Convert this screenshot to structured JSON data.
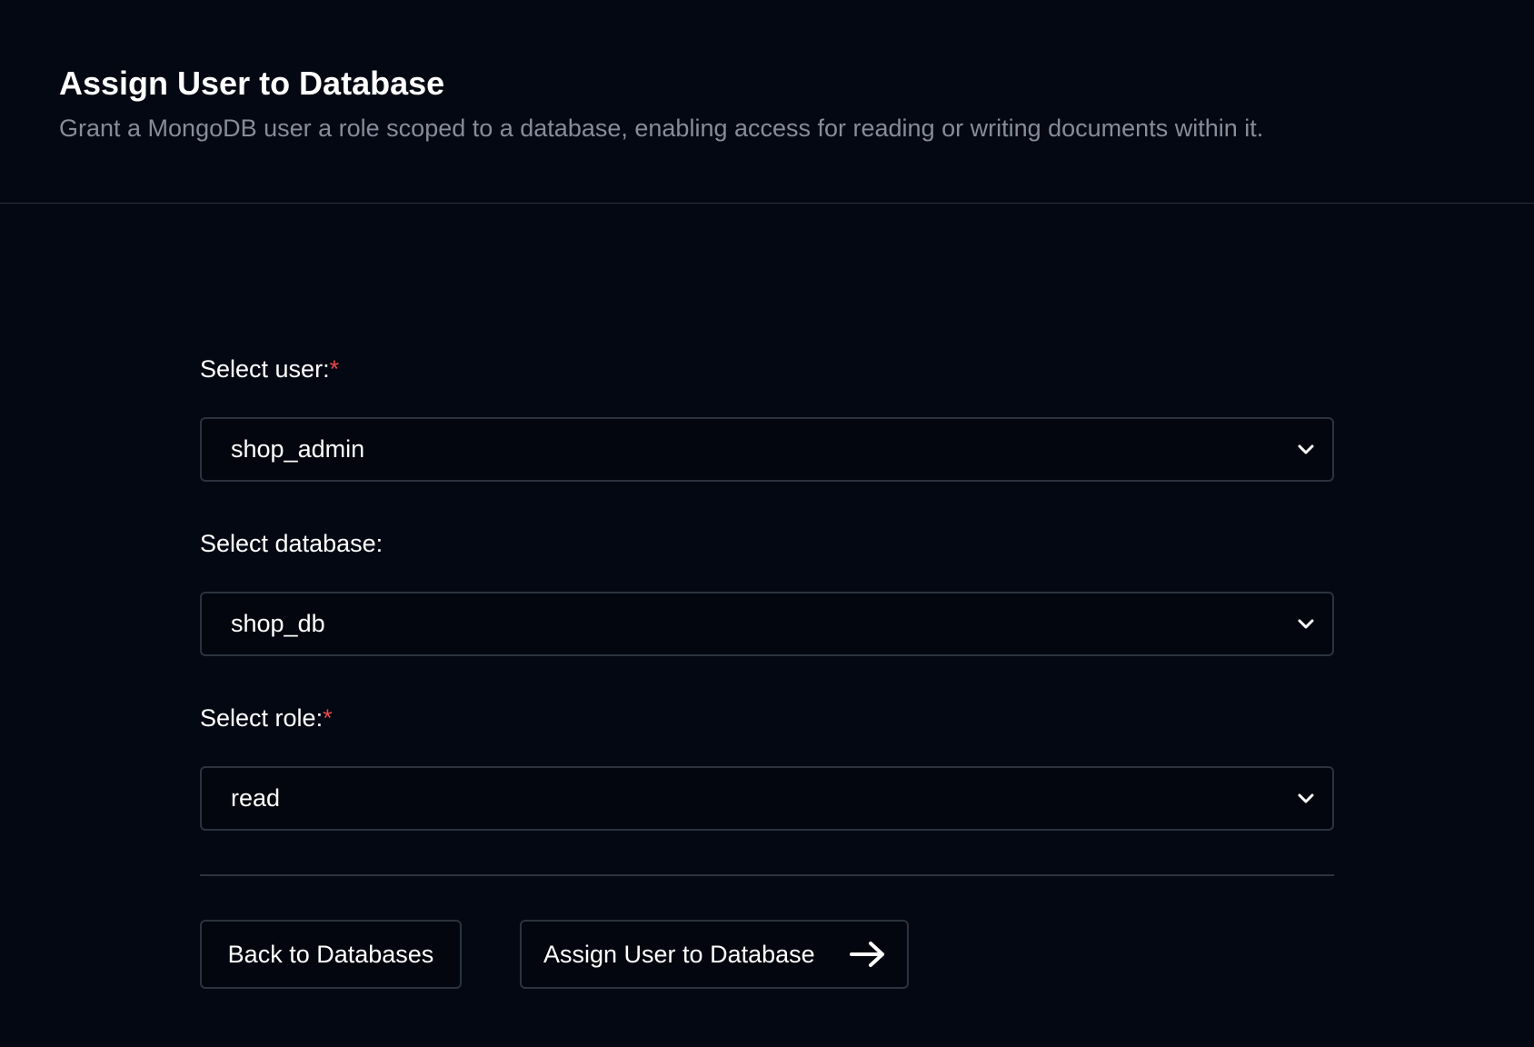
{
  "header": {
    "title": "Assign User to Database",
    "subtitle": "Grant a MongoDB user a role scoped to a database, enabling access for reading or writing documents within it."
  },
  "form": {
    "user": {
      "label": "Select user:",
      "required_mark": "*",
      "value": "shop_admin"
    },
    "database": {
      "label": "Select database:",
      "value": "shop_db"
    },
    "role": {
      "label": "Select role:",
      "required_mark": "*",
      "value": "read"
    }
  },
  "actions": {
    "back_label": "Back to Databases",
    "assign_label": "Assign User to Database"
  },
  "icons": {
    "select_indicator": "chevron-down-icon",
    "submit_indicator": "arrow-right-icon"
  },
  "colors": {
    "background": "#040812",
    "border": "#2c323e",
    "subtitle": "#868c99",
    "required": "#e5484d"
  }
}
